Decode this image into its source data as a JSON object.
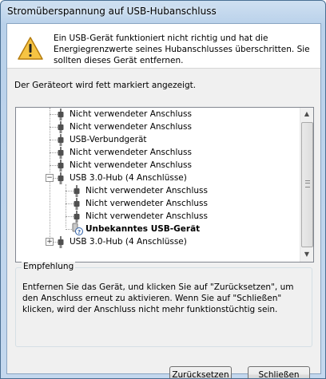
{
  "window": {
    "title": "Stromüberspannung auf USB-Hubanschluss"
  },
  "header": {
    "icon": "warning-icon",
    "message": "Ein USB-Gerät funktioniert nicht richtig und hat die Energiegrenzwerte seines Hubanschlusses überschritten. Sie sollten dieses Gerät entfernen."
  },
  "location_text": "Der Geräteort wird fett markiert angezeigt.",
  "tree": {
    "items": [
      {
        "label": "Nicht verwendeter Anschluss",
        "icon": "usb-plug-icon",
        "bold": false
      },
      {
        "label": "Nicht verwendeter Anschluss",
        "icon": "usb-plug-icon",
        "bold": false
      },
      {
        "label": "USB-Verbundgerät",
        "icon": "usb-plug-icon",
        "bold": false
      },
      {
        "label": "Nicht verwendeter Anschluss",
        "icon": "usb-plug-icon",
        "bold": false
      },
      {
        "label": "Nicht verwendeter Anschluss",
        "icon": "usb-plug-icon",
        "bold": false
      },
      {
        "label": "USB 3.0-Hub (4 Anschlüsse)",
        "icon": "usb-plug-icon",
        "bold": false,
        "expanded": true
      },
      {
        "label": "Nicht verwendeter Anschluss",
        "icon": "usb-plug-icon",
        "bold": false
      },
      {
        "label": "Nicht verwendeter Anschluss",
        "icon": "usb-plug-icon",
        "bold": false
      },
      {
        "label": "Nicht verwendeter Anschluss",
        "icon": "usb-plug-icon",
        "bold": false
      },
      {
        "label": "Unbekanntes USB-Gerät",
        "icon": "unknown-device-icon",
        "bold": true
      },
      {
        "label": "USB 3.0-Hub (4 Anschlüsse)",
        "icon": "usb-plug-icon",
        "bold": false,
        "expanded": false
      }
    ]
  },
  "recommendation": {
    "title": "Empfehlung",
    "text": "Entfernen Sie das Gerät, und klicken Sie auf \"Zurücksetzen\", um den Anschluss erneut zu aktivieren. Wenn Sie auf \"Schließen\" klicken, wird der Anschluss nicht mehr funktionstüchtig sein."
  },
  "buttons": {
    "reset": "Zurücksetzen",
    "close": "Schließen"
  }
}
